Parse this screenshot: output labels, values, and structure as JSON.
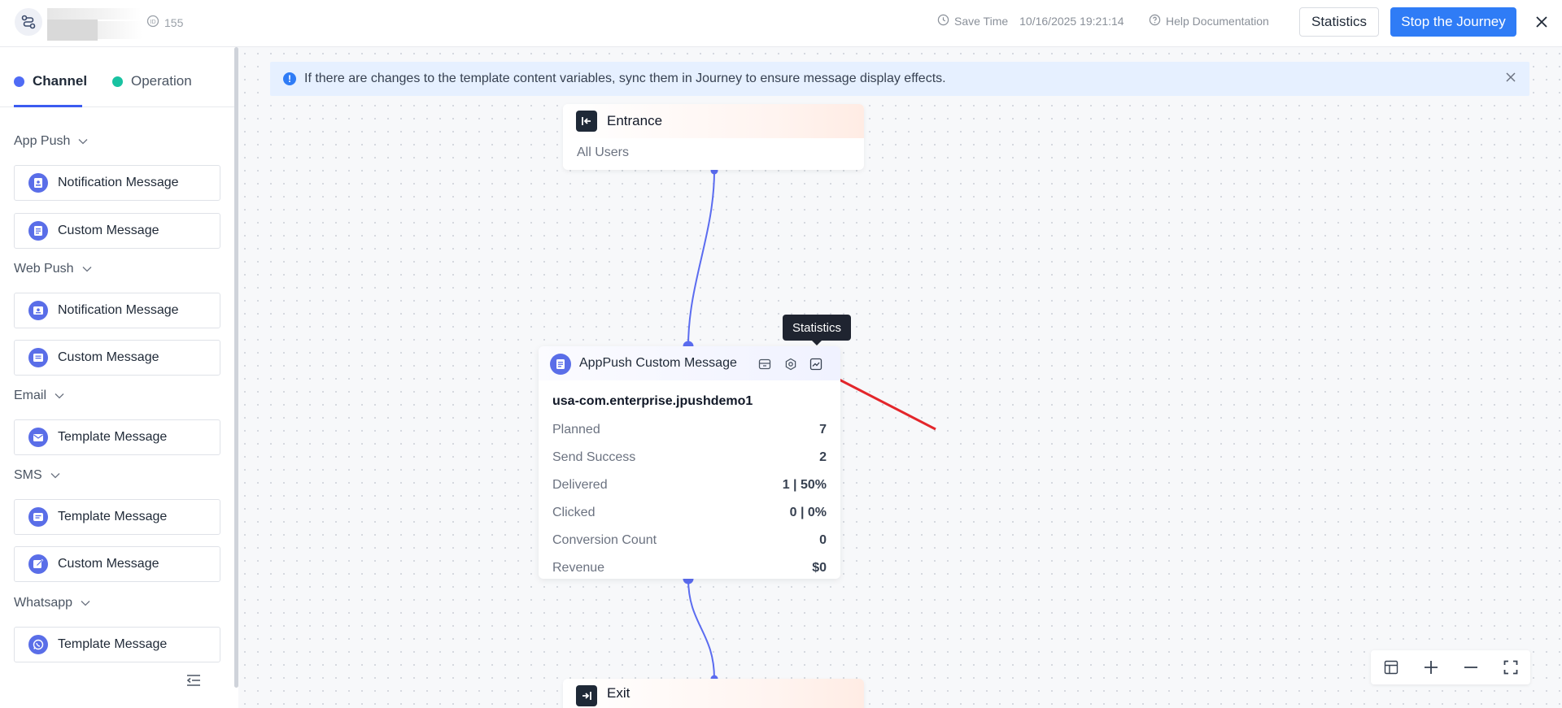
{
  "header": {
    "id_value": "155",
    "save_time_label": "Save Time",
    "save_time_value": "10/16/2025 19:21:14",
    "help_label": "Help Documentation",
    "statistics_button": "Statistics",
    "stop_button": "Stop the Journey"
  },
  "sidebar": {
    "tabs": [
      {
        "label": "Channel",
        "active": true
      },
      {
        "label": "Operation",
        "active": false
      }
    ],
    "groups": [
      {
        "label": "App Push",
        "items": [
          "Notification Message",
          "Custom Message"
        ]
      },
      {
        "label": "Web Push",
        "items": [
          "Notification Message",
          "Custom Message"
        ]
      },
      {
        "label": "Email",
        "items": [
          "Template Message"
        ]
      },
      {
        "label": "SMS",
        "items": [
          "Template Message",
          "Custom Message"
        ]
      },
      {
        "label": "Whatsapp",
        "items": [
          "Template Message"
        ]
      }
    ]
  },
  "canvas": {
    "banner_text": "If there are changes to the template content variables, sync them in Journey to ensure message display effects.",
    "entrance": {
      "title": "Entrance",
      "subtitle": "All Users"
    },
    "message_node": {
      "title": "AppPush Custom Message",
      "app": "usa-com.enterprise.jpushdemo1",
      "stats": [
        {
          "label": "Planned",
          "value": "7"
        },
        {
          "label": "Send Success",
          "value": "2"
        },
        {
          "label": "Delivered",
          "value": "1 | 50%"
        },
        {
          "label": "Clicked",
          "value": "0 | 0%"
        },
        {
          "label": "Conversion Count",
          "value": "0"
        },
        {
          "label": "Revenue",
          "value": "$0"
        }
      ]
    },
    "tooltip": "Statistics",
    "exit": {
      "title": "Exit"
    }
  },
  "colors": {
    "primary": "#2f7cf6",
    "channel_dot": "#4f6bf5",
    "operation_dot": "#19c2a1",
    "connector": "#5b6cf0",
    "annotation_arrow": "#e3262b"
  }
}
